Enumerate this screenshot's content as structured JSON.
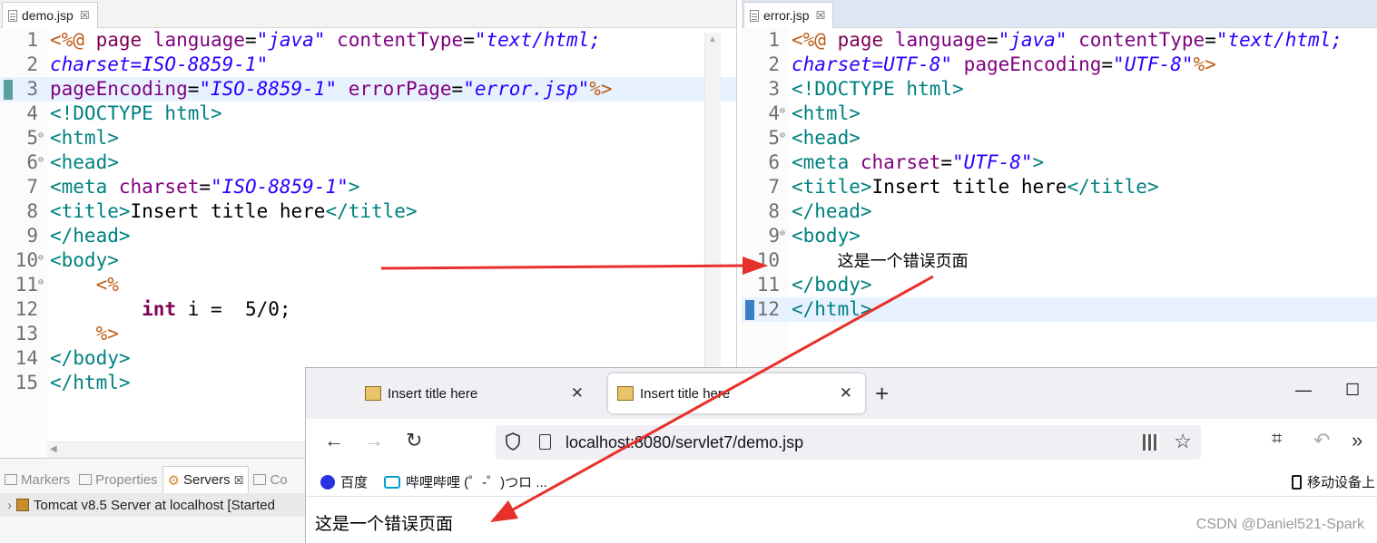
{
  "left_editor": {
    "tab_label": "demo.jsp",
    "tab_close": "☒",
    "lines": [
      {
        "num": "1",
        "tokens": [
          [
            "dir",
            "<%@ "
          ],
          [
            "kw",
            "page "
          ],
          [
            "attr",
            "language"
          ],
          [
            "txt",
            "="
          ],
          [
            "str",
            "\"java\""
          ],
          [
            "txt",
            " "
          ],
          [
            "attr",
            "contentType"
          ],
          [
            "txt",
            "="
          ],
          [
            "str",
            "\"text/html;"
          ]
        ]
      },
      {
        "num": "2",
        "tokens": [
          [
            "str",
            "charset=ISO-8859-1\""
          ]
        ]
      },
      {
        "num": "3",
        "current": true,
        "marker": true,
        "tokens": [
          [
            "attr",
            "pageEncoding"
          ],
          [
            "txt",
            "="
          ],
          [
            "str",
            "\"ISO-8859-1\""
          ],
          [
            "txt",
            " "
          ],
          [
            "attr",
            "errorPage"
          ],
          [
            "txt",
            "="
          ],
          [
            "str",
            "\"error.jsp\""
          ],
          [
            "dir",
            "%>"
          ]
        ]
      },
      {
        "num": "4",
        "tokens": [
          [
            "tag",
            "<!DOCTYPE html>"
          ]
        ]
      },
      {
        "num": "5",
        "fold": true,
        "tokens": [
          [
            "tag",
            "<html>"
          ]
        ]
      },
      {
        "num": "6",
        "fold": true,
        "tokens": [
          [
            "tag",
            "<head>"
          ]
        ]
      },
      {
        "num": "7",
        "tokens": [
          [
            "tag",
            "<meta "
          ],
          [
            "attr",
            "charset"
          ],
          [
            "txt",
            "="
          ],
          [
            "str",
            "\"ISO-8859-1\""
          ],
          [
            "tag",
            ">"
          ]
        ]
      },
      {
        "num": "8",
        "tokens": [
          [
            "tag",
            "<title>"
          ],
          [
            "txt",
            "Insert title here"
          ],
          [
            "tag",
            "</title>"
          ]
        ]
      },
      {
        "num": "9",
        "tokens": [
          [
            "tag",
            "</head>"
          ]
        ]
      },
      {
        "num": "10",
        "fold": true,
        "tokens": [
          [
            "tag",
            "<body>"
          ]
        ]
      },
      {
        "num": "11",
        "fold": true,
        "tokens": [
          [
            "txt",
            "    "
          ],
          [
            "dir",
            "<%"
          ]
        ]
      },
      {
        "num": "12",
        "tokens": [
          [
            "txt",
            "        "
          ],
          [
            "kwb",
            "int"
          ],
          [
            "txt",
            " i =  5/0;"
          ]
        ]
      },
      {
        "num": "13",
        "tokens": [
          [
            "txt",
            "    "
          ],
          [
            "dir",
            "%>"
          ]
        ]
      },
      {
        "num": "14",
        "tokens": [
          [
            "tag",
            "</body>"
          ]
        ]
      },
      {
        "num": "15",
        "tokens": [
          [
            "tag",
            "</html>"
          ]
        ]
      }
    ]
  },
  "right_editor": {
    "tab_label": "error.jsp",
    "tab_close": "☒",
    "lines": [
      {
        "num": "1",
        "tokens": [
          [
            "dir",
            "<%@ "
          ],
          [
            "kw",
            "page "
          ],
          [
            "attr",
            "language"
          ],
          [
            "txt",
            "="
          ],
          [
            "str",
            "\"java\""
          ],
          [
            "txt",
            " "
          ],
          [
            "attr",
            "contentType"
          ],
          [
            "txt",
            "="
          ],
          [
            "str",
            "\"text/html;"
          ]
        ]
      },
      {
        "num": "2",
        "tokens": [
          [
            "str",
            "charset=UTF-8\""
          ],
          [
            "txt",
            " "
          ],
          [
            "attr",
            "pageEncoding"
          ],
          [
            "txt",
            "="
          ],
          [
            "str",
            "\"UTF-8\""
          ],
          [
            "dir",
            "%>"
          ]
        ]
      },
      {
        "num": "3",
        "tokens": [
          [
            "tag",
            "<!DOCTYPE html>"
          ]
        ]
      },
      {
        "num": "4",
        "fold": true,
        "tokens": [
          [
            "tag",
            "<html>"
          ]
        ]
      },
      {
        "num": "5",
        "fold": true,
        "tokens": [
          [
            "tag",
            "<head>"
          ]
        ]
      },
      {
        "num": "6",
        "tokens": [
          [
            "tag",
            "<meta "
          ],
          [
            "attr",
            "charset"
          ],
          [
            "txt",
            "="
          ],
          [
            "str",
            "\"UTF-8\""
          ],
          [
            "tag",
            ">"
          ]
        ]
      },
      {
        "num": "7",
        "tokens": [
          [
            "tag",
            "<title>"
          ],
          [
            "txt",
            "Insert title here"
          ],
          [
            "tag",
            "</title>"
          ]
        ]
      },
      {
        "num": "8",
        "tokens": [
          [
            "tag",
            "</head>"
          ]
        ]
      },
      {
        "num": "9",
        "fold": true,
        "tokens": [
          [
            "tag",
            "<body>"
          ]
        ]
      },
      {
        "num": "10",
        "tokens": [
          [
            "txt",
            "    "
          ],
          [
            "cn",
            "这是一个错误页面"
          ]
        ]
      },
      {
        "num": "11",
        "tokens": [
          [
            "tag",
            "</body>"
          ]
        ]
      },
      {
        "num": "12",
        "current": true,
        "marker": true,
        "tokens": [
          [
            "tag",
            "</html>"
          ]
        ]
      }
    ]
  },
  "views": {
    "tabs": [
      "Markers",
      "Properties",
      "Servers",
      "Co"
    ],
    "active_tab": "Servers",
    "server_row": "Tomcat v8.5 Server at localhost  [Started"
  },
  "browser": {
    "tab1_title": "Insert title here",
    "tab2_title": "Insert title here",
    "new_tab": "+",
    "minimize": "—",
    "maximize": "☐",
    "url": "localhost:8080/servlet7/demo.jsp",
    "bookmarks": [
      "百度",
      "哔哩哔哩 (゜-゜)つロ ..."
    ],
    "mobile_bookmarks": "移动设备上",
    "page_text": "这是一个错误页面"
  },
  "watermark": "CSDN @Daniel521-Spark",
  "colors": {
    "directive": "#bf5b17",
    "keyword": "#7f0055",
    "attribute": "#7f007f",
    "string": "#2a00ff",
    "tag": "#008080",
    "arrow": "#e8302a",
    "current_line": "#e8f2fe"
  }
}
